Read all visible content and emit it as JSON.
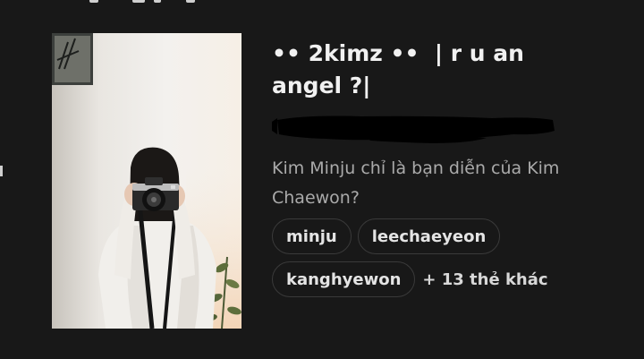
{
  "playlist": {
    "title": "•• 2kimz ••  | r u an angel ?|",
    "description": "Kim Minju chỉ là bạn diễn của Kim Chaewon?",
    "thumbnail_icon": "photo-girl-with-camera",
    "subtitle_redacted": true,
    "tags": [
      {
        "label": "minju"
      },
      {
        "label": "leechaeyeon"
      },
      {
        "label": "kanghyewon"
      }
    ],
    "more_tags_text": "+ 13 thẻ khác"
  },
  "colors": {
    "background": "#181818",
    "title": "#f1f1f1",
    "description": "#aaaaaa",
    "tag_border": "#3a3a3a",
    "tag_text": "#e4e4e4"
  }
}
